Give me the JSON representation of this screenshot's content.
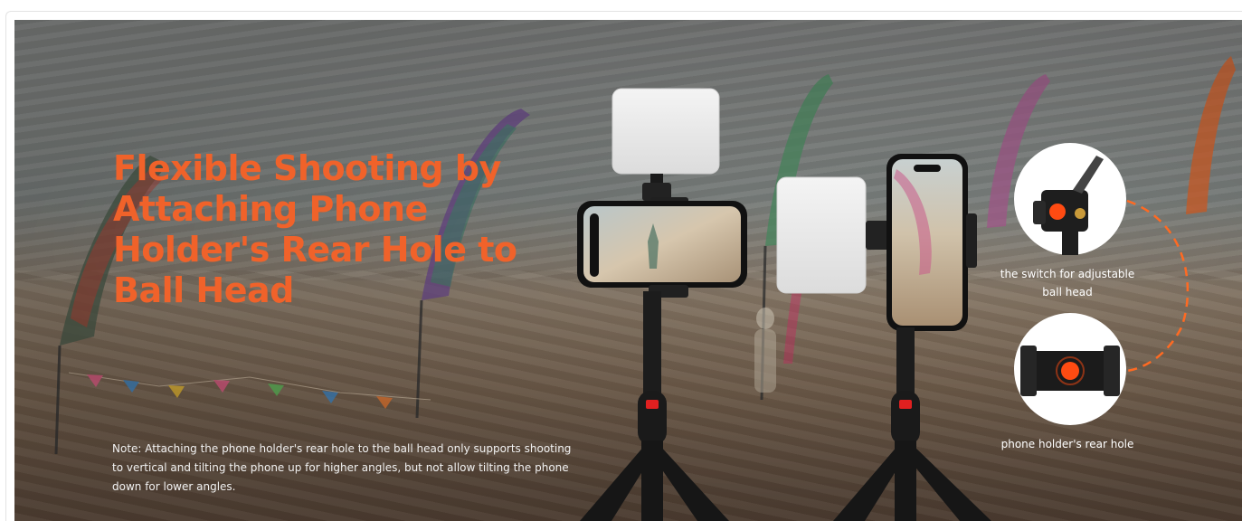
{
  "headline": "Flexible Shooting by Attaching Phone Holder's Rear Hole to Ball Head",
  "note": "Note: Attaching the phone holder's rear hole to the ball head only supports shooting to vertical and tilting the phone up for higher angles, but not allow tilting the phone down for lower angles.",
  "detail_captions": {
    "ball_head_switch": "the switch for adjustable ball head",
    "rear_hole": "phone holder's rear hole"
  },
  "colors": {
    "headline": "#f0622a",
    "accent_dot": "#ff4b12",
    "connector_dash": "#ff6a22",
    "text_light": "#ffffff",
    "tripod": "#1a1a1a",
    "light_panel": "#ededed"
  }
}
